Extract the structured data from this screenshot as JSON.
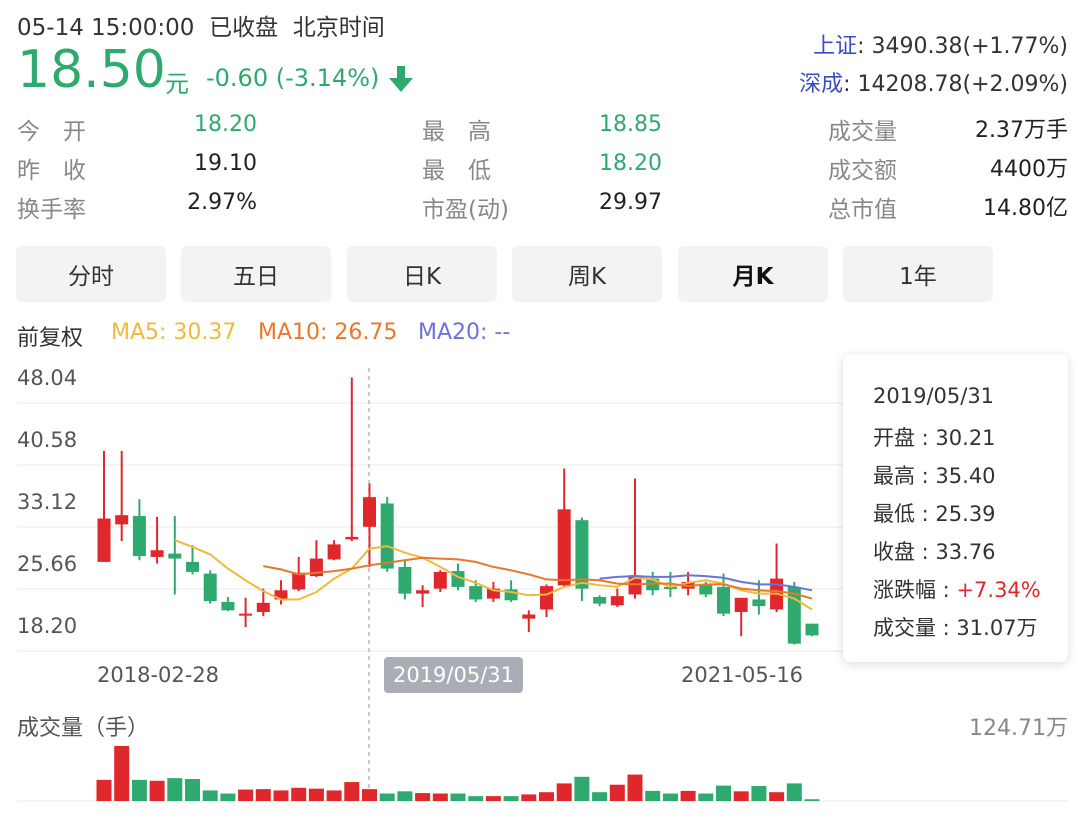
{
  "header": {
    "datetime": "05-14 15:00:00",
    "status": "已收盘",
    "timezone": "北京时间",
    "price": "18.50",
    "unit": "元",
    "change": "-0.60 (-3.14%)",
    "direction_icon": "down-arrow-icon"
  },
  "indices": [
    {
      "name": "上证",
      "value": ": 3490.38(+1.77%)"
    },
    {
      "name": "深成",
      "value": ": 14208.78(+2.09%)"
    }
  ],
  "stats": [
    {
      "label": "今　开",
      "value": "18.20"
    },
    {
      "label": "昨　收",
      "value": "19.10"
    },
    {
      "label": "换手率",
      "value": "2.97%"
    },
    {
      "label": "最　高",
      "value": "18.85"
    },
    {
      "label": "最　低",
      "value": "18.20"
    },
    {
      "label": "市盈(动)",
      "value": "29.97"
    },
    {
      "label": "成交量",
      "value": "2.37万手"
    },
    {
      "label": "成交额",
      "value": "4400万"
    },
    {
      "label": "总市值",
      "value": "14.80亿"
    }
  ],
  "tabs": [
    {
      "label": "分时",
      "active": false
    },
    {
      "label": "五日",
      "active": false
    },
    {
      "label": "日K",
      "active": false
    },
    {
      "label": "周K",
      "active": false
    },
    {
      "label": "月K",
      "active": true
    },
    {
      "label": "1年",
      "active": false
    }
  ],
  "ma": {
    "adjust": "前复权",
    "ma5": "MA5: 30.37",
    "ma10": "MA10: 26.75",
    "ma20": "MA20: --"
  },
  "colors": {
    "up": "#e0272b",
    "down": "#2eaa6e",
    "ma5": "#f0b93a",
    "ma10": "#e8782a",
    "ma20": "#6a73d9",
    "index_link": "#3b4cc0"
  },
  "chart_data": {
    "type": "candlestick",
    "y_ticks": [
      "48.04",
      "40.58",
      "33.12",
      "25.66",
      "18.20"
    ],
    "ylim": [
      18.2,
      48.04
    ],
    "x_labels": [
      "2018-02-28",
      "2019/05/31",
      "2021-05-16"
    ],
    "candles": [
      {
        "o": 26.0,
        "h": 39.3,
        "l": 26.0,
        "c": 31.2
      },
      {
        "o": 30.5,
        "h": 39.3,
        "l": 28.5,
        "c": 31.6
      },
      {
        "o": 31.5,
        "h": 33.5,
        "l": 26.2,
        "c": 26.7
      },
      {
        "o": 26.6,
        "h": 31.4,
        "l": 25.8,
        "c": 27.4
      },
      {
        "o": 27.0,
        "h": 31.5,
        "l": 22.1,
        "c": 26.4
      },
      {
        "o": 26.0,
        "h": 28.0,
        "l": 24.5,
        "c": 24.8
      },
      {
        "o": 24.6,
        "h": 25.0,
        "l": 21.0,
        "c": 21.3
      },
      {
        "o": 21.2,
        "h": 21.8,
        "l": 20.1,
        "c": 20.2
      },
      {
        "o": 19.7,
        "h": 21.7,
        "l": 18.2,
        "c": 19.8
      },
      {
        "o": 20.0,
        "h": 22.8,
        "l": 19.5,
        "c": 21.1
      },
      {
        "o": 21.5,
        "h": 23.8,
        "l": 20.9,
        "c": 22.6
      },
      {
        "o": 22.7,
        "h": 26.6,
        "l": 22.5,
        "c": 24.7
      },
      {
        "o": 24.3,
        "h": 28.6,
        "l": 24.2,
        "c": 26.4
      },
      {
        "o": 26.3,
        "h": 28.6,
        "l": 26.2,
        "c": 28.1
      },
      {
        "o": 28.7,
        "h": 48.1,
        "l": 28.5,
        "c": 29.0
      },
      {
        "o": 30.21,
        "h": 35.4,
        "l": 25.39,
        "c": 33.76
      },
      {
        "o": 33.0,
        "h": 33.8,
        "l": 24.8,
        "c": 25.2
      },
      {
        "o": 25.4,
        "h": 26.3,
        "l": 21.5,
        "c": 22.2
      },
      {
        "o": 22.2,
        "h": 23.2,
        "l": 20.6,
        "c": 22.6
      },
      {
        "o": 22.8,
        "h": 25.0,
        "l": 22.4,
        "c": 24.8
      },
      {
        "o": 24.9,
        "h": 25.8,
        "l": 22.6,
        "c": 23.0
      },
      {
        "o": 23.1,
        "h": 23.8,
        "l": 21.2,
        "c": 21.5
      },
      {
        "o": 21.6,
        "h": 23.6,
        "l": 21.2,
        "c": 22.8
      },
      {
        "o": 22.7,
        "h": 23.8,
        "l": 21.2,
        "c": 21.4
      },
      {
        "o": 19.2,
        "h": 20.2,
        "l": 17.6,
        "c": 19.7
      },
      {
        "o": 20.3,
        "h": 23.3,
        "l": 19.4,
        "c": 23.1
      },
      {
        "o": 23.2,
        "h": 37.2,
        "l": 23.0,
        "c": 32.3
      },
      {
        "o": 31.0,
        "h": 31.3,
        "l": 21.3,
        "c": 22.8
      },
      {
        "o": 21.8,
        "h": 22.0,
        "l": 20.7,
        "c": 21.0
      },
      {
        "o": 20.8,
        "h": 22.8,
        "l": 20.6,
        "c": 21.9
      },
      {
        "o": 22.1,
        "h": 36.0,
        "l": 21.6,
        "c": 24.4
      },
      {
        "o": 24.0,
        "h": 24.8,
        "l": 22.0,
        "c": 22.6
      },
      {
        "o": 23.0,
        "h": 24.8,
        "l": 21.8,
        "c": 22.8
      },
      {
        "o": 22.8,
        "h": 24.8,
        "l": 22.0,
        "c": 23.6
      },
      {
        "o": 23.2,
        "h": 23.6,
        "l": 21.8,
        "c": 22.1
      },
      {
        "o": 23.0,
        "h": 24.6,
        "l": 19.5,
        "c": 19.8
      },
      {
        "o": 20.0,
        "h": 20.6,
        "l": 17.1,
        "c": 21.7
      },
      {
        "o": 21.5,
        "h": 23.8,
        "l": 19.7,
        "c": 20.7
      },
      {
        "o": 20.3,
        "h": 28.2,
        "l": 20.0,
        "c": 24.0
      },
      {
        "o": 23.0,
        "h": 23.6,
        "l": 16.1,
        "c": 16.2
      },
      {
        "o": 18.6,
        "h": 18.6,
        "l": 17.1,
        "c": 17.2
      }
    ],
    "ma_series": [
      {
        "name": "MA5",
        "values": [
          null,
          null,
          null,
          null,
          28.6,
          27.8,
          26.9,
          25.2,
          23.8,
          22.5,
          21.5,
          21.5,
          22.4,
          24.0,
          25.2,
          27.6,
          27.9,
          27.1,
          26.5,
          25.4,
          24.2,
          23.5,
          22.6,
          22.4,
          22.0,
          22.1,
          23.0,
          23.5,
          23.2,
          23.0,
          24.1,
          23.9,
          23.0,
          23.5,
          23.8,
          23.4,
          22.6,
          22.2,
          22.2,
          21.6,
          20.3
        ]
      },
      {
        "name": "MA10",
        "values": [
          null,
          null,
          null,
          null,
          null,
          null,
          null,
          null,
          null,
          25.5,
          25.1,
          24.5,
          24.7,
          24.9,
          25.2,
          25.6,
          25.9,
          26.2,
          26.5,
          26.4,
          26.3,
          26.0,
          25.4,
          25.0,
          24.5,
          23.9,
          23.8,
          23.9,
          23.8,
          23.4,
          23.3,
          23.4,
          23.4,
          23.1,
          23.3,
          23.3,
          22.8,
          22.6,
          22.5,
          22.2,
          21.6
        ]
      },
      {
        "name": "MA20",
        "values": [
          null,
          null,
          null,
          null,
          null,
          null,
          null,
          null,
          null,
          null,
          null,
          null,
          null,
          null,
          null,
          null,
          null,
          null,
          null,
          null,
          null,
          null,
          null,
          null,
          null,
          null,
          null,
          null,
          24.0,
          24.2,
          24.3,
          24.2,
          24.2,
          24.4,
          24.3,
          24.1,
          23.6,
          23.3,
          23.3,
          23.0,
          22.6
        ]
      }
    ],
    "volume": {
      "label": "成交量（手）",
      "max_label": "124.71万",
      "values": [
        48,
        125,
        48,
        46,
        52,
        50,
        24,
        17,
        26,
        27,
        24,
        30,
        28,
        24,
        43,
        27,
        17,
        22,
        18,
        17,
        17,
        11,
        11,
        11,
        15,
        20,
        40,
        55,
        20,
        37,
        60,
        23,
        17,
        23,
        17,
        35,
        22,
        34,
        20,
        40,
        4
      ]
    },
    "tooltip": {
      "date": "2019/05/31",
      "open": "开盘 : 30.21",
      "high": "最高 : 35.40",
      "low": "最低 : 25.39",
      "close": "收盘 : 33.76",
      "change_label": "涨跌幅 : ",
      "change_value": "+7.34%",
      "volume": "成交量 : 31.07万"
    }
  }
}
